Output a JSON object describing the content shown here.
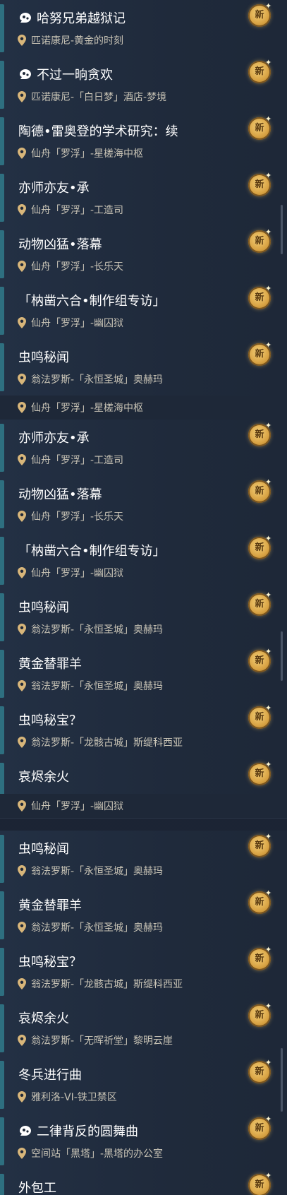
{
  "badge_text": "新",
  "segments": [
    {
      "items": [
        {
          "title": "哈努兄弟越狱记",
          "location": "匹诺康尼-黄金的时刻",
          "quest_icon": true
        },
        {
          "title": "不过一晌贪欢",
          "location": "匹诺康尼-「白日梦」酒店-梦境",
          "quest_icon": true
        },
        {
          "title": "陶德•雷奥登的学术研究：续",
          "location": "仙舟「罗浮」-星槎海中枢"
        },
        {
          "title": "亦师亦友•承",
          "location": "仙舟「罗浮」-工造司"
        },
        {
          "title": "动物凶猛•落幕",
          "location": "仙舟「罗浮」-长乐天"
        },
        {
          "title": "「枘凿六合•制作组专访」",
          "location": "仙舟「罗浮」-幽囚狱"
        },
        {
          "title": "虫鸣秘闻",
          "location": "翁法罗斯-「永恒圣城」奥赫玛"
        }
      ]
    },
    {
      "strip_location": "仙舟「罗浮」-星槎海中枢",
      "items": [
        {
          "title": "亦师亦友•承",
          "location": "仙舟「罗浮」-工造司"
        },
        {
          "title": "动物凶猛•落幕",
          "location": "仙舟「罗浮」-长乐天"
        },
        {
          "title": "「枘凿六合•制作组专访」",
          "location": "仙舟「罗浮」-幽囚狱"
        },
        {
          "title": "虫鸣秘闻",
          "location": "翁法罗斯-「永恒圣城」奥赫玛"
        },
        {
          "title": "黄金替罪羊",
          "location": "翁法罗斯-「永恒圣城」奥赫玛"
        },
        {
          "title": "虫鸣秘宝？",
          "location": "翁法罗斯-「龙骸古城」斯缇科西亚"
        },
        {
          "title": "哀烬余火",
          "location": ""
        }
      ]
    },
    {
      "strip_location": "仙舟「罗浮」-幽囚狱",
      "items": [
        {
          "title": "虫鸣秘闻",
          "location": "翁法罗斯-「永恒圣城」奥赫玛"
        },
        {
          "title": "黄金替罪羊",
          "location": "翁法罗斯-「永恒圣城」奥赫玛"
        },
        {
          "title": "虫鸣秘宝？",
          "location": "翁法罗斯-「龙骸古城」斯缇科西亚"
        },
        {
          "title": "哀烬余火",
          "location": "翁法罗斯-「无晖祈堂」黎明云崖"
        },
        {
          "title": "冬兵进行曲",
          "location": "雅利洛-VI-铁卫禁区"
        },
        {
          "title": "二律背反的圆舞曲",
          "location": "空间站「黑塔」-黑塔的办公室",
          "quest_icon": true
        },
        {
          "title": "外包工",
          "location": ""
        }
      ]
    }
  ]
}
